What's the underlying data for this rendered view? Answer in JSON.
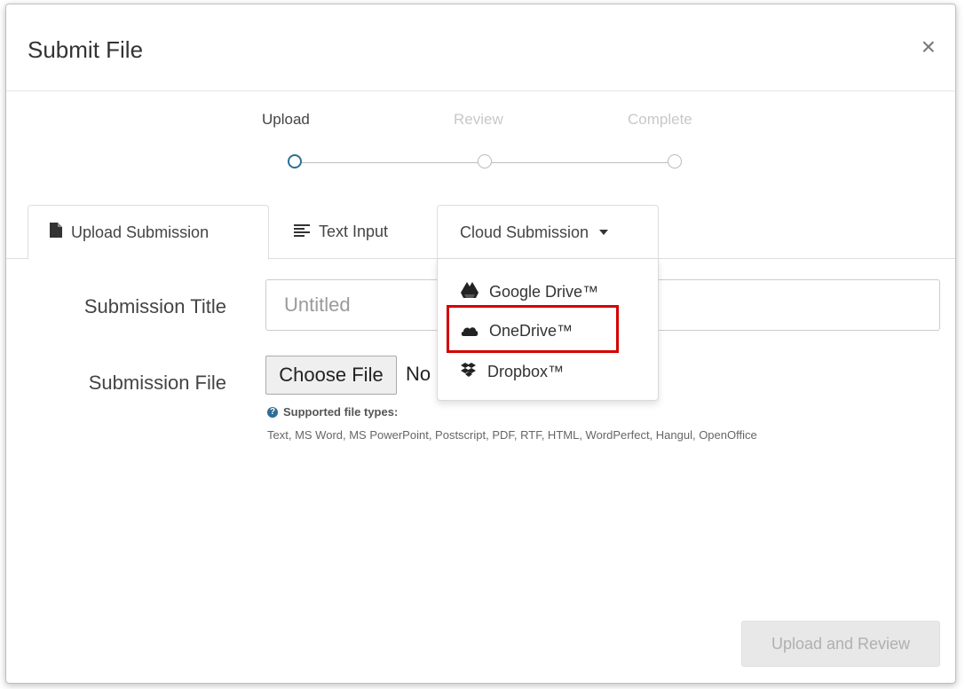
{
  "dialog": {
    "title": "Submit File",
    "close_symbol": "×"
  },
  "stepper": {
    "steps": [
      {
        "label": "Upload",
        "state": "active"
      },
      {
        "label": "Review",
        "state": "inactive"
      },
      {
        "label": "Complete",
        "state": "inactive"
      }
    ],
    "active_color": "#2c6e96"
  },
  "tabs": [
    {
      "label": "Upload Submission",
      "icon": "file-icon",
      "active": true
    },
    {
      "label": "Text Input",
      "icon": "align-left-icon",
      "active": false
    },
    {
      "label": "Cloud Submission",
      "icon": "caret-down-icon",
      "active": false,
      "dropdown_open": true
    }
  ],
  "cloud_menu": {
    "items": [
      {
        "label": "Google Drive™",
        "icon": "google-drive-icon"
      },
      {
        "label": "OneDrive™",
        "icon": "onedrive-icon",
        "highlighted": true
      },
      {
        "label": "Dropbox™",
        "icon": "dropbox-icon"
      }
    ],
    "highlight_color": "#d40000"
  },
  "form": {
    "title_label": "Submission Title",
    "title_placeholder": "Untitled",
    "title_value": "",
    "file_label": "Submission File",
    "choose_file_label": "Choose File",
    "no_file_text": "No",
    "help_heading": "Supported file types:",
    "file_types": "Text, MS Word, MS PowerPoint, Postscript, PDF, RTF, HTML, WordPerfect, Hangul, OpenOffice"
  },
  "actions": {
    "upload_review_label": "Upload and Review",
    "upload_review_enabled": false
  }
}
